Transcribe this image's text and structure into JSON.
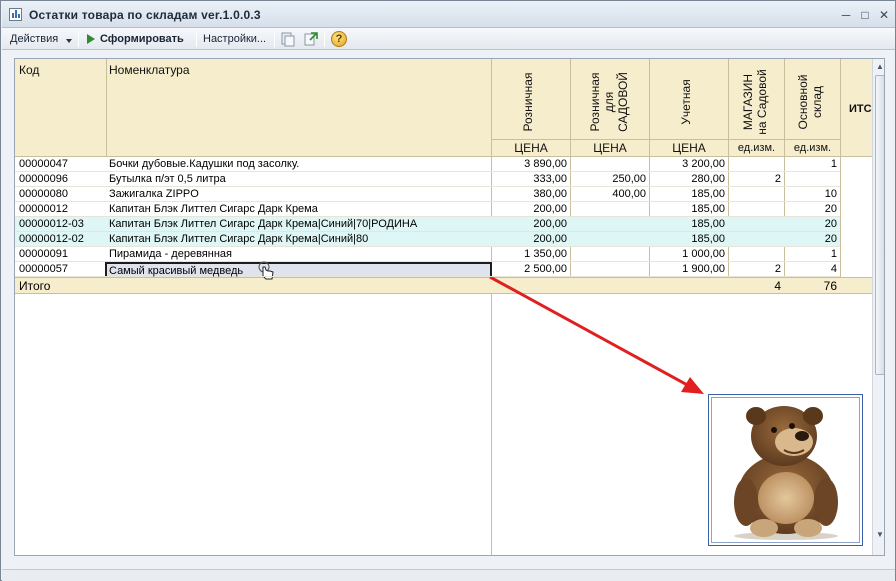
{
  "window": {
    "title": "Остатки товара по складам ver.1.0.0.3",
    "minimize": "─",
    "maximize": "□",
    "close": "✕"
  },
  "toolbar": {
    "actions_label": "Действия",
    "generate_label": "Сформировать",
    "settings_label": "Настройки...",
    "help_label": "?"
  },
  "table": {
    "headers": {
      "code": "Код",
      "name": "Номенклатура",
      "retail": "Розничная",
      "retail_sadovaya": [
        "Розничная",
        "для",
        "САДОВОЙ"
      ],
      "accounting": "Учетная",
      "shop_sadovaya": [
        "МАГАЗИН",
        "на Садовой"
      ],
      "main_store": [
        "Основной",
        "склад"
      ],
      "total_partial": "ИТС"
    },
    "subheaders": {
      "retail": "ЦЕНА",
      "retail_sadovaya": "ЦЕНА",
      "accounting": "ЦЕНА",
      "shop_sadovaya": "ед.изм.",
      "main_store": "ед.изм."
    },
    "rows": [
      {
        "code": "00000047",
        "name": "Бочки дубовые.Кадушки под засолку.",
        "retail": "3 890,00",
        "retail_sad": "",
        "accounting": "3 200,00",
        "shop": "",
        "main": "1"
      },
      {
        "code": "00000096",
        "name": "Бутылка п/эт 0,5 литра",
        "retail": "333,00",
        "retail_sad": "250,00",
        "accounting": "280,00",
        "shop": "2",
        "main": ""
      },
      {
        "code": "00000080",
        "name": "Зажигалка ZIPPO",
        "retail": "380,00",
        "retail_sad": "400,00",
        "accounting": "185,00",
        "shop": "",
        "main": "10"
      },
      {
        "code": "00000012",
        "name": "Капитан Блэк Литтел Сигарс Дарк Крема",
        "retail": "200,00",
        "retail_sad": "",
        "accounting": "185,00",
        "shop": "",
        "main": "20"
      },
      {
        "code": "00000012-03",
        "name": "Капитан Блэк Литтел Сигарс Дарк Крема|Синий|70|РОДИНА",
        "retail": "200,00",
        "retail_sad": "",
        "accounting": "185,00",
        "shop": "",
        "main": "20"
      },
      {
        "code": "00000012-02",
        "name": "Капитан Блэк Литтел Сигарс Дарк Крема|Синий|80",
        "retail": "200,00",
        "retail_sad": "",
        "accounting": "185,00",
        "shop": "",
        "main": "20"
      },
      {
        "code": "00000091",
        "name": "Пирамида - деревянная",
        "retail": "1 350,00",
        "retail_sad": "",
        "accounting": "1 000,00",
        "shop": "",
        "main": "1"
      },
      {
        "code": "00000057",
        "name": "Самый красивый медведь",
        "retail": "2 500,00",
        "retail_sad": "",
        "accounting": "1 900,00",
        "shop": "2",
        "main": "4"
      }
    ],
    "total": {
      "label": "Итого",
      "shop": "4",
      "main": "76"
    }
  },
  "preview": {
    "subject": "teddy-bear"
  }
}
